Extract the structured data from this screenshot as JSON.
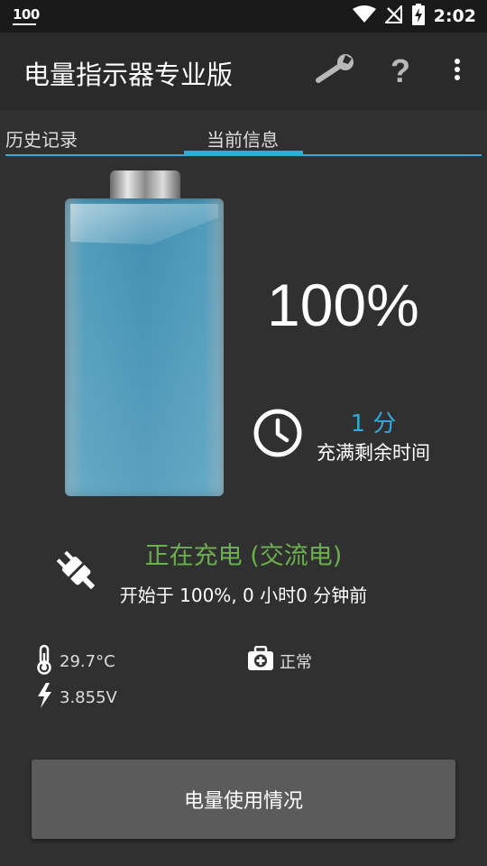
{
  "status_bar": {
    "left_text": "100",
    "time": "2:02",
    "icons": [
      "wifi-icon",
      "no-signal-icon",
      "battery-charging-icon"
    ]
  },
  "app_bar": {
    "title": "电量指示器专业版",
    "actions": [
      "wrench-icon",
      "help-icon",
      "more-vert-icon"
    ]
  },
  "tabs": {
    "items": [
      {
        "label": "历史记录",
        "selected": false
      },
      {
        "label": "当前信息",
        "selected": true
      }
    ]
  },
  "battery": {
    "level_fraction": 1.0,
    "percent_text": "100%"
  },
  "time_remaining": {
    "value": "1 分",
    "label": "充满剩余时间"
  },
  "charging": {
    "status": "正在充电 (交流电)",
    "since": "开始于 100%, 0 小时0 分钟前"
  },
  "details": {
    "temperature": "29.7°C",
    "health": "正常",
    "voltage": "3.855V"
  },
  "usage_button": {
    "label": "电量使用情况"
  },
  "colors": {
    "accent": "#33a9d9",
    "charging_green": "#6ab04c",
    "background": "#303030",
    "app_bar": "#2a2a2a",
    "status_bar": "#1a1a1a",
    "button": "#5b5b5b"
  }
}
